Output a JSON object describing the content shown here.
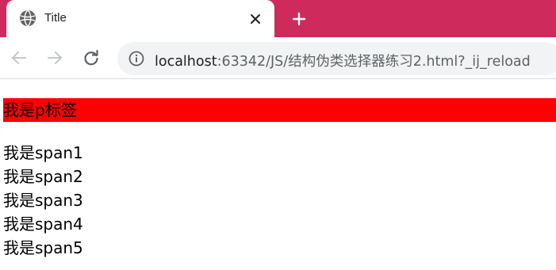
{
  "browser": {
    "tab_title": "Title",
    "url_host": "localhost",
    "url_rest": ":63342/JS/结构伪类选择器练习2.html?_ij_reload",
    "colors": {
      "tabstrip": "#cf2a5c",
      "omnibox": "#f1f3f4"
    },
    "icons": [
      "globe-icon",
      "close-icon",
      "plus-icon",
      "back-arrow-icon",
      "forward-arrow-icon",
      "reload-icon",
      "info-icon"
    ]
  },
  "page": {
    "p_text": "我是p标签",
    "p_background": "#ff0000",
    "spans": [
      "我是span1",
      "我是span2",
      "我是span3",
      "我是span4",
      "我是span5"
    ]
  }
}
